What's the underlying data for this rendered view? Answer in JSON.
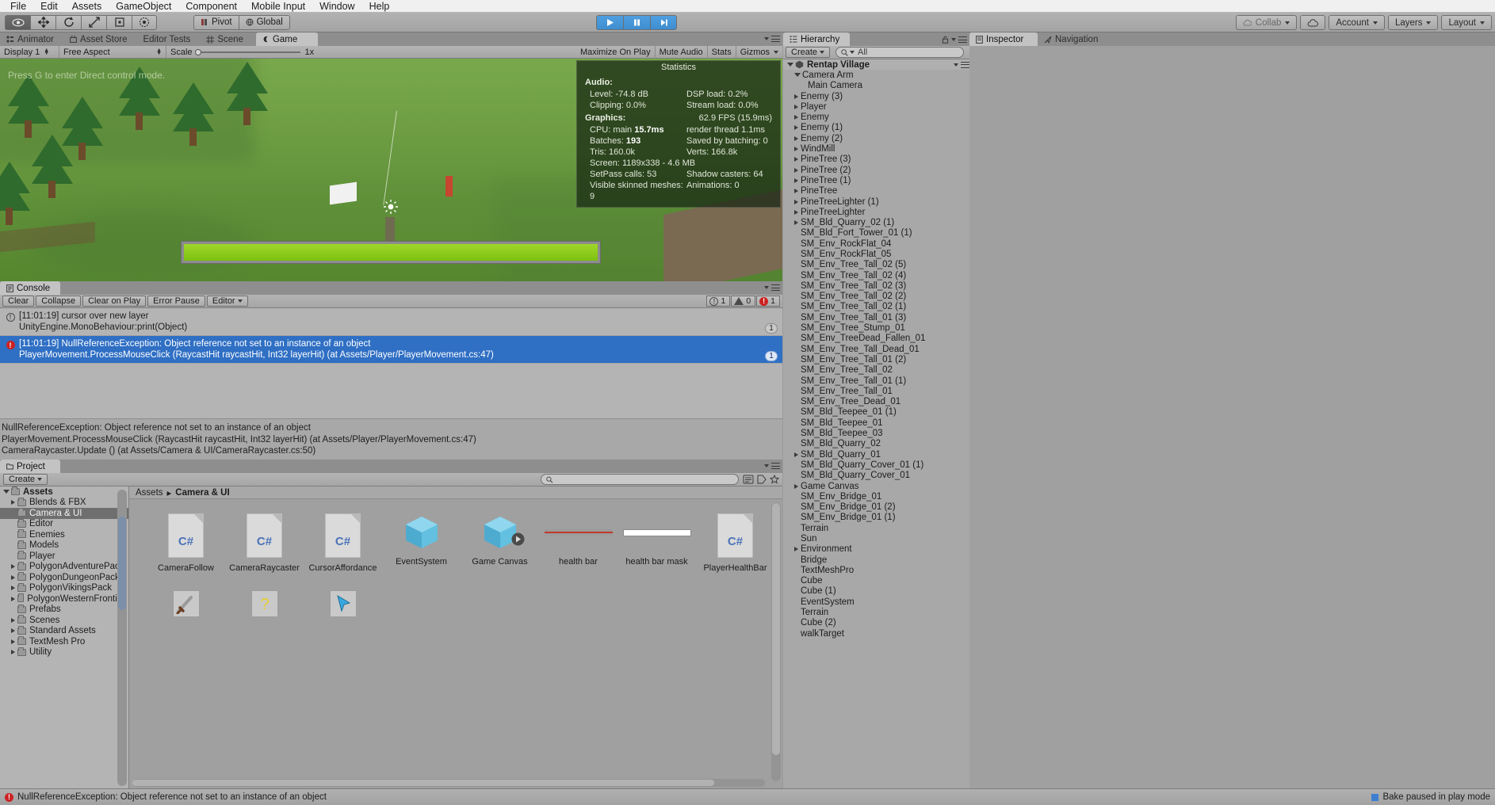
{
  "menubar": {
    "items": [
      "File",
      "Edit",
      "Assets",
      "GameObject",
      "Component",
      "Mobile Input",
      "Window",
      "Help"
    ]
  },
  "toolbar": {
    "tools": [
      "hand-tool",
      "move-tool",
      "rotate-tool",
      "scale-tool",
      "rect-tool",
      "transform-tool"
    ],
    "pivot_label": "Pivot",
    "global_label": "Global",
    "play_label": "play-button",
    "pause_label": "pause-button",
    "step_label": "step-button",
    "collab_label": "Collab",
    "cloud_label": "cloud-icon",
    "account_label": "Account",
    "layers_label": "Layers",
    "layout_label": "Layout",
    "accent_play": "#3e8ed0"
  },
  "editor_tabs": {
    "items": [
      "Animator",
      "Asset Store",
      "Editor Tests",
      "Scene",
      "Game"
    ],
    "selected": "Game"
  },
  "game_view": {
    "display": "Display 1",
    "aspect": "Free Aspect",
    "scale_label": "Scale",
    "scale_value": "1x",
    "maximize": "Maximize On Play",
    "mute": "Mute Audio",
    "stats": "Stats",
    "gizmos": "Gizmos",
    "hint": "Press G to enter Direct control mode."
  },
  "statistics": {
    "title": "Statistics",
    "audio_header": "Audio:",
    "audio_rows": [
      {
        "left": "Level: -74.8 dB",
        "right": "DSP load: 0.2%"
      },
      {
        "left": "Clipping: 0.0%",
        "right": "Stream load: 0.0%"
      }
    ],
    "graphics_header": "Graphics:",
    "fps": "62.9 FPS (15.9ms)",
    "graphics_rows": [
      {
        "left": "CPU: main ",
        "left_bold": "15.7ms",
        "right": "render thread 1.1ms"
      },
      {
        "left": "Batches: ",
        "left_bold": "193",
        "right": "Saved by batching: 0"
      },
      {
        "left": "Tris: 160.0k",
        "left_bold": "",
        "right": "Verts: 166.8k"
      },
      {
        "left": "Screen: 1189x338 - 4.6 MB",
        "left_bold": "",
        "right": ""
      },
      {
        "left": "SetPass calls: 53",
        "left_bold": "",
        "right": "Shadow casters: 64"
      },
      {
        "left": "Visible skinned meshes: 9",
        "left_bold": "",
        "right": "Animations: 0"
      }
    ]
  },
  "console": {
    "tab": "Console",
    "buttons": [
      "Clear",
      "Collapse",
      "Clear on Play",
      "Error Pause",
      "Editor"
    ],
    "counts": {
      "info": "1",
      "warn": "0",
      "error": "1"
    },
    "entries": [
      {
        "type": "info",
        "line1": "[11:01:19] cursor over new layer",
        "line2": "UnityEngine.MonoBehaviour:print(Object)",
        "badge": "1",
        "selected": false
      },
      {
        "type": "error",
        "line1": "[11:01:19] NullReferenceException: Object reference not set to an instance of an object",
        "line2": "PlayerMovement.ProcessMouseClick (RaycastHit raycastHit, Int32 layerHit) (at Assets/Player/PlayerMovement.cs:47)",
        "badge": "1",
        "selected": true
      }
    ],
    "stack": [
      "NullReferenceException: Object reference not set to an instance of an object",
      "PlayerMovement.ProcessMouseClick (RaycastHit raycastHit, Int32 layerHit) (at Assets/Player/PlayerMovement.cs:47)",
      "CameraRaycaster.Update () (at Assets/Camera & UI/CameraRaycaster.cs:50)"
    ]
  },
  "project": {
    "tab": "Project",
    "create_label": "Create",
    "search_placeholder": "",
    "breadcrumb": [
      "Assets",
      "Camera & UI"
    ],
    "tree": [
      {
        "label": "Assets",
        "depth": 0,
        "arrow": "open",
        "bold": true,
        "selected": false
      },
      {
        "label": "Blends & FBX",
        "depth": 1,
        "arrow": "closed",
        "bold": false,
        "selected": false
      },
      {
        "label": "Camera & UI",
        "depth": 1,
        "arrow": "none",
        "bold": false,
        "selected": true
      },
      {
        "label": "Editor",
        "depth": 1,
        "arrow": "none",
        "bold": false,
        "selected": false
      },
      {
        "label": "Enemies",
        "depth": 1,
        "arrow": "none",
        "bold": false,
        "selected": false
      },
      {
        "label": "Models",
        "depth": 1,
        "arrow": "none",
        "bold": false,
        "selected": false
      },
      {
        "label": "Player",
        "depth": 1,
        "arrow": "none",
        "bold": false,
        "selected": false
      },
      {
        "label": "PolygonAdventurePack",
        "depth": 1,
        "arrow": "closed",
        "bold": false,
        "selected": false
      },
      {
        "label": "PolygonDungeonPack",
        "depth": 1,
        "arrow": "closed",
        "bold": false,
        "selected": false
      },
      {
        "label": "PolygonVikingsPack",
        "depth": 1,
        "arrow": "closed",
        "bold": false,
        "selected": false
      },
      {
        "label": "PolygonWesternFrontier",
        "depth": 1,
        "arrow": "closed",
        "bold": false,
        "selected": false
      },
      {
        "label": "Prefabs",
        "depth": 1,
        "arrow": "none",
        "bold": false,
        "selected": false
      },
      {
        "label": "Scenes",
        "depth": 1,
        "arrow": "closed",
        "bold": false,
        "selected": false
      },
      {
        "label": "Standard Assets",
        "depth": 1,
        "arrow": "closed",
        "bold": false,
        "selected": false
      },
      {
        "label": "TextMesh Pro",
        "depth": 1,
        "arrow": "closed",
        "bold": false,
        "selected": false
      },
      {
        "label": "Utility",
        "depth": 1,
        "arrow": "closed",
        "bold": false,
        "selected": false
      }
    ],
    "assets": [
      {
        "name": "CameraFollow",
        "icon": "csharp-script-icon"
      },
      {
        "name": "CameraRaycaster",
        "icon": "csharp-script-icon"
      },
      {
        "name": "CursorAffordance",
        "icon": "csharp-script-icon"
      },
      {
        "name": "EventSystem",
        "icon": "prefab-cube-icon"
      },
      {
        "name": "Game Canvas",
        "icon": "prefab-cube-icon"
      },
      {
        "name": "health bar",
        "icon": "health-bar-icon"
      },
      {
        "name": "health bar mask",
        "icon": "health-bar-mask-icon"
      },
      {
        "name": "PlayerHealthBar",
        "icon": "csharp-script-icon"
      },
      {
        "name": "",
        "icon": "sword-cursor-icon"
      },
      {
        "name": "",
        "icon": "question-cursor-icon"
      },
      {
        "name": "",
        "icon": "arrow-cursor-icon"
      }
    ]
  },
  "hierarchy": {
    "tab": "Hierarchy",
    "create_label": "Create",
    "search_value": "All",
    "scene_root": "Rentap Village",
    "items": [
      {
        "label": "Camera Arm",
        "depth": 1,
        "arrow": "open"
      },
      {
        "label": "Main Camera",
        "depth": 2,
        "arrow": "none"
      },
      {
        "label": "Enemy (3)",
        "depth": 1,
        "arrow": "closed"
      },
      {
        "label": "Player",
        "depth": 1,
        "arrow": "closed"
      },
      {
        "label": "Enemy",
        "depth": 1,
        "arrow": "closed"
      },
      {
        "label": "Enemy (1)",
        "depth": 1,
        "arrow": "closed"
      },
      {
        "label": "Enemy (2)",
        "depth": 1,
        "arrow": "closed"
      },
      {
        "label": "WindMill",
        "depth": 1,
        "arrow": "closed"
      },
      {
        "label": "PineTree (3)",
        "depth": 1,
        "arrow": "closed"
      },
      {
        "label": "PineTree (2)",
        "depth": 1,
        "arrow": "closed"
      },
      {
        "label": "PineTree (1)",
        "depth": 1,
        "arrow": "closed"
      },
      {
        "label": "PineTree",
        "depth": 1,
        "arrow": "closed"
      },
      {
        "label": "PineTreeLighter (1)",
        "depth": 1,
        "arrow": "closed"
      },
      {
        "label": "PineTreeLighter",
        "depth": 1,
        "arrow": "closed"
      },
      {
        "label": "SM_Bld_Quarry_02 (1)",
        "depth": 1,
        "arrow": "closed"
      },
      {
        "label": "SM_Bld_Fort_Tower_01 (1)",
        "depth": 1,
        "arrow": "none"
      },
      {
        "label": "SM_Env_RockFlat_04",
        "depth": 1,
        "arrow": "none"
      },
      {
        "label": "SM_Env_RockFlat_05",
        "depth": 1,
        "arrow": "none"
      },
      {
        "label": "SM_Env_Tree_Tall_02 (5)",
        "depth": 1,
        "arrow": "none"
      },
      {
        "label": "SM_Env_Tree_Tall_02 (4)",
        "depth": 1,
        "arrow": "none"
      },
      {
        "label": "SM_Env_Tree_Tall_02 (3)",
        "depth": 1,
        "arrow": "none"
      },
      {
        "label": "SM_Env_Tree_Tall_02 (2)",
        "depth": 1,
        "arrow": "none"
      },
      {
        "label": "SM_Env_Tree_Tall_02 (1)",
        "depth": 1,
        "arrow": "none"
      },
      {
        "label": "SM_Env_Tree_Tall_01 (3)",
        "depth": 1,
        "arrow": "none"
      },
      {
        "label": "SM_Env_Tree_Stump_01",
        "depth": 1,
        "arrow": "none"
      },
      {
        "label": "SM_Env_TreeDead_Fallen_01",
        "depth": 1,
        "arrow": "none"
      },
      {
        "label": "SM_Env_Tree_Tall_Dead_01",
        "depth": 1,
        "arrow": "none"
      },
      {
        "label": "SM_Env_Tree_Tall_01 (2)",
        "depth": 1,
        "arrow": "none"
      },
      {
        "label": "SM_Env_Tree_Tall_02",
        "depth": 1,
        "arrow": "none"
      },
      {
        "label": "SM_Env_Tree_Tall_01 (1)",
        "depth": 1,
        "arrow": "none"
      },
      {
        "label": "SM_Env_Tree_Tall_01",
        "depth": 1,
        "arrow": "none"
      },
      {
        "label": "SM_Env_Tree_Dead_01",
        "depth": 1,
        "arrow": "none"
      },
      {
        "label": "SM_Bld_Teepee_01 (1)",
        "depth": 1,
        "arrow": "none"
      },
      {
        "label": "SM_Bld_Teepee_01",
        "depth": 1,
        "arrow": "none"
      },
      {
        "label": "SM_Bld_Teepee_03",
        "depth": 1,
        "arrow": "none"
      },
      {
        "label": "SM_Bld_Quarry_02",
        "depth": 1,
        "arrow": "none"
      },
      {
        "label": "SM_Bld_Quarry_01",
        "depth": 1,
        "arrow": "closed"
      },
      {
        "label": "SM_Bld_Quarry_Cover_01 (1)",
        "depth": 1,
        "arrow": "none"
      },
      {
        "label": "SM_Bld_Quarry_Cover_01",
        "depth": 1,
        "arrow": "none"
      },
      {
        "label": "Game Canvas",
        "depth": 1,
        "arrow": "closed"
      },
      {
        "label": "SM_Env_Bridge_01",
        "depth": 1,
        "arrow": "none"
      },
      {
        "label": "SM_Env_Bridge_01 (2)",
        "depth": 1,
        "arrow": "none"
      },
      {
        "label": "SM_Env_Bridge_01 (1)",
        "depth": 1,
        "arrow": "none"
      },
      {
        "label": "Terrain",
        "depth": 1,
        "arrow": "none"
      },
      {
        "label": "Sun",
        "depth": 1,
        "arrow": "none"
      },
      {
        "label": "Environment",
        "depth": 1,
        "arrow": "closed"
      },
      {
        "label": "Bridge",
        "depth": 1,
        "arrow": "none"
      },
      {
        "label": "TextMeshPro",
        "depth": 1,
        "arrow": "none"
      },
      {
        "label": "Cube",
        "depth": 1,
        "arrow": "none"
      },
      {
        "label": "Cube (1)",
        "depth": 1,
        "arrow": "none"
      },
      {
        "label": "EventSystem",
        "depth": 1,
        "arrow": "none"
      },
      {
        "label": "Terrain",
        "depth": 1,
        "arrow": "none"
      },
      {
        "label": "Cube (2)",
        "depth": 1,
        "arrow": "none"
      },
      {
        "label": "walkTarget",
        "depth": 1,
        "arrow": "none"
      }
    ]
  },
  "inspector": {
    "tabs": [
      "Inspector",
      "Navigation"
    ],
    "selected": "Inspector"
  },
  "statusbar": {
    "message": "NullReferenceException: Object reference not set to an instance of an object",
    "bake_message": "Bake paused in play mode"
  }
}
